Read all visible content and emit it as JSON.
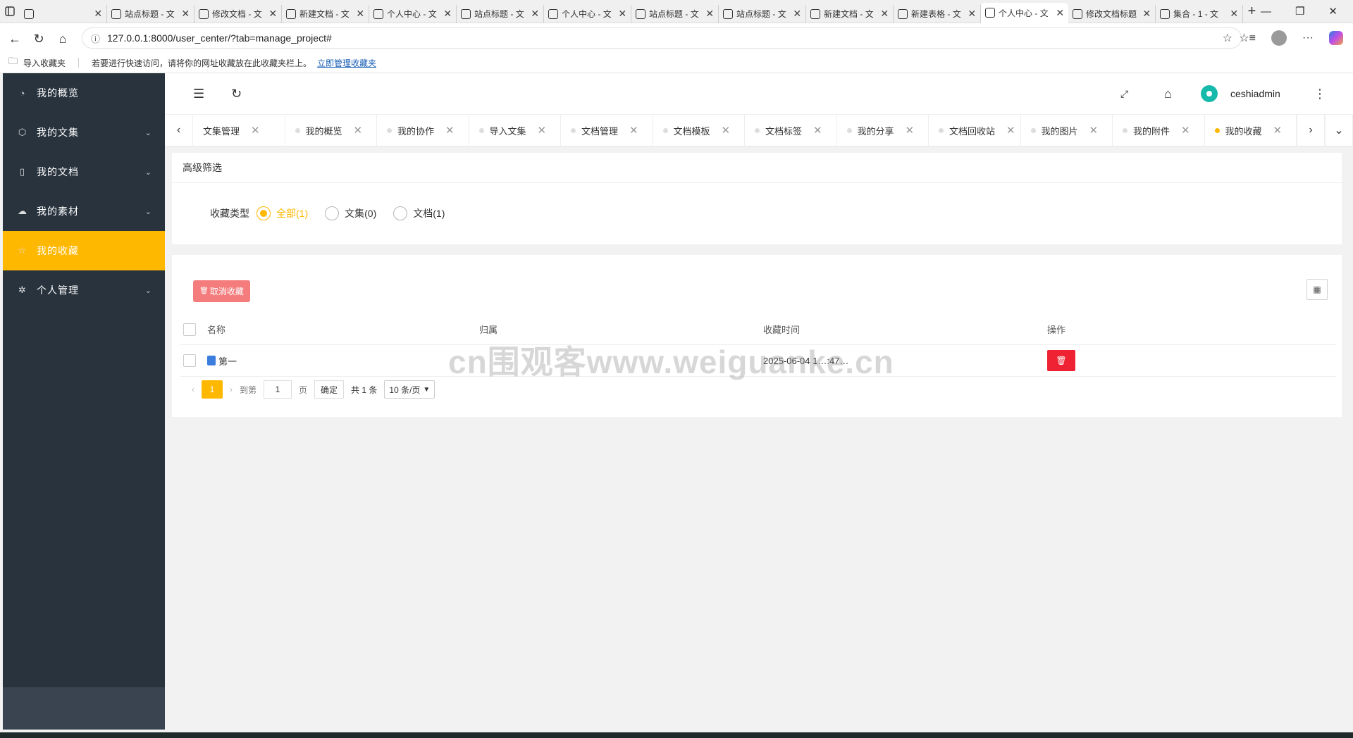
{
  "browser": {
    "tabs": [
      {
        "title": ""
      },
      {
        "title": "站点标题 - 文"
      },
      {
        "title": "修改文档 - 文"
      },
      {
        "title": "新建文档 - 文"
      },
      {
        "title": "个人中心 - 文"
      },
      {
        "title": "站点标题 - 文"
      },
      {
        "title": "个人中心 - 文"
      },
      {
        "title": "站点标题 - 文"
      },
      {
        "title": "站点标题 - 文"
      },
      {
        "title": "新建文档 - 文"
      },
      {
        "title": "新建表格 - 文"
      },
      {
        "title": "个人中心 - 文",
        "active": true
      },
      {
        "title": "修改文档标题"
      },
      {
        "title": "集合 - 1 - 文"
      }
    ],
    "url": "127.0.0.1:8000/user_center/?tab=manage_project#",
    "bookmarks": {
      "import_label": "导入收藏夹",
      "hint": "若要进行快速访问，请将你的网址收藏放在此收藏夹栏上。",
      "manage_link": "立即管理收藏夹"
    }
  },
  "sidebar": {
    "items": [
      {
        "label": "我的概览",
        "icon": "dashboard-icon",
        "glyph": "◔",
        "has_arrow": false
      },
      {
        "label": "我的文集",
        "icon": "cube-icon",
        "glyph": "⬡",
        "has_arrow": true
      },
      {
        "label": "我的文档",
        "icon": "file-icon",
        "glyph": "▯",
        "has_arrow": true
      },
      {
        "label": "我的素材",
        "icon": "cloud-upload-icon",
        "glyph": "☁",
        "has_arrow": true
      },
      {
        "label": "我的收藏",
        "icon": "star-icon",
        "glyph": "☆",
        "has_arrow": false,
        "active": true
      },
      {
        "label": "个人管理",
        "icon": "gear-icon",
        "glyph": "✲",
        "has_arrow": true
      }
    ]
  },
  "header": {
    "username": "ceshiadmin"
  },
  "page_tabs": [
    {
      "label": "文集管理",
      "dot": false
    },
    {
      "label": "我的概览",
      "dot": true
    },
    {
      "label": "我的协作",
      "dot": true
    },
    {
      "label": "导入文集",
      "dot": true
    },
    {
      "label": "文档管理",
      "dot": true
    },
    {
      "label": "文档模板",
      "dot": true
    },
    {
      "label": "文档标签",
      "dot": true
    },
    {
      "label": "我的分享",
      "dot": true
    },
    {
      "label": "文档回收站",
      "dot": true
    },
    {
      "label": "我的图片",
      "dot": true
    },
    {
      "label": "我的附件",
      "dot": true
    },
    {
      "label": "我的收藏",
      "dot": true,
      "active": true
    }
  ],
  "filter": {
    "title": "高级筛选",
    "type_label": "收藏类型",
    "options": [
      {
        "label": "全部(1)",
        "checked": true
      },
      {
        "label": "文集(0)",
        "checked": false
      },
      {
        "label": "文档(1)",
        "checked": false
      }
    ]
  },
  "list": {
    "cancel_button": "取消收藏",
    "columns": [
      "名称",
      "归属",
      "收藏时间",
      "操作"
    ],
    "rows": [
      {
        "name": "第一",
        "owner": "",
        "time": "2025-06-04 1…:47…"
      }
    ],
    "pager": {
      "current": "1",
      "goto_label": "到第",
      "goto_value": "1",
      "page_unit": "页",
      "confirm": "确定",
      "total": "共 1 条",
      "page_size": "10 条/页"
    }
  },
  "watermark": "cn围观客www.weiguanke.cn",
  "colors": {
    "accent": "#ffb800",
    "sidebar_bg": "#28333e",
    "danger": "#ee2233",
    "cancel_btn": "#f47c7c"
  }
}
